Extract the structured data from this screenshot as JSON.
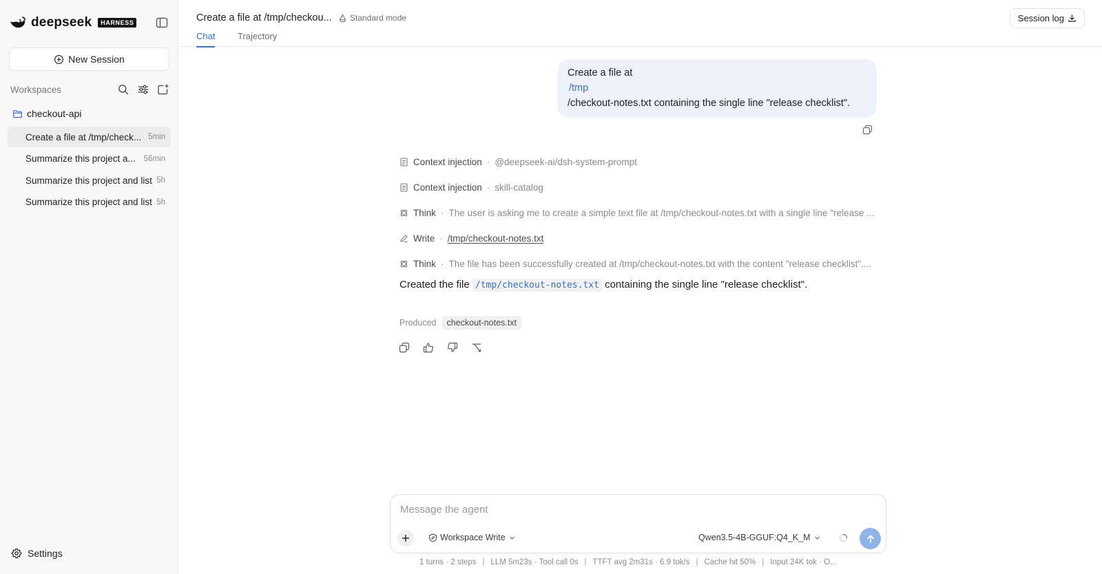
{
  "brand": {
    "name": "deepseek",
    "badge": "HARNESS"
  },
  "sidebar": {
    "new_session_label": "New Session",
    "workspaces_title": "Workspaces",
    "project_name": "checkout-api",
    "sessions": [
      {
        "label": "Create a file at /tmp/check...",
        "time": "5min",
        "active": true
      },
      {
        "label": "Summarize this project a...",
        "time": "56min",
        "active": false
      },
      {
        "label": "Summarize this project and list",
        "time": "5h",
        "active": false
      },
      {
        "label": "Summarize this project and list",
        "time": "5h",
        "active": false
      }
    ],
    "settings_label": "Settings"
  },
  "header": {
    "title": "Create a file at /tmp/checkou...",
    "mode_label": "Standard mode",
    "tabs": [
      {
        "label": "Chat",
        "active": true
      },
      {
        "label": "Trajectory",
        "active": false
      }
    ],
    "session_log_label": "Session log"
  },
  "chat": {
    "user_message": {
      "line1": "Create a file at",
      "link": "/tmp",
      "line3": "/checkout-notes.txt containing the single line \"release checklist\"."
    },
    "steps": [
      {
        "icon": "document-icon",
        "kind": "Context injection",
        "detail": "@deepseek-ai/dsh-system-prompt"
      },
      {
        "icon": "document-icon",
        "kind": "Context injection",
        "detail": "skill-catalog"
      },
      {
        "icon": "think-icon",
        "kind": "Think",
        "detail": "The user is asking me to create a simple text file at /tmp/checkout-notes.txt with a single line \"release ..."
      },
      {
        "icon": "pencil-icon",
        "kind": "Write",
        "detail": "/tmp/checkout-notes.txt"
      },
      {
        "icon": "think-icon",
        "kind": "Think",
        "detail": "The file has been successfully created at /tmp/checkout-notes.txt with the content \"release checklist\"...."
      }
    ],
    "answer": {
      "prefix": "Created the file",
      "code": "/tmp/checkout-notes.txt",
      "suffix": "containing the single line \"release checklist\"."
    },
    "produced_label": "Produced",
    "produced_file": "checkout-notes.txt"
  },
  "composer": {
    "placeholder": "Message the agent",
    "permission_label": "Workspace Write",
    "model_label": "Qwen3.5-4B-GGUF:Q4_K_M"
  },
  "stats": [
    "1 turns · 2 steps",
    "LLM 5m23s · Tool call 0s",
    "TTFT avg 2m31s · 6.9 tok/s",
    "Cache hit 50%",
    "Input 24K tok · O..."
  ],
  "colors": {
    "accent": "#3a6fb5",
    "user_bubble": "#ecf1fa",
    "send_button": "#8fb4ea",
    "sidebar_bg": "#f8f8f9"
  }
}
